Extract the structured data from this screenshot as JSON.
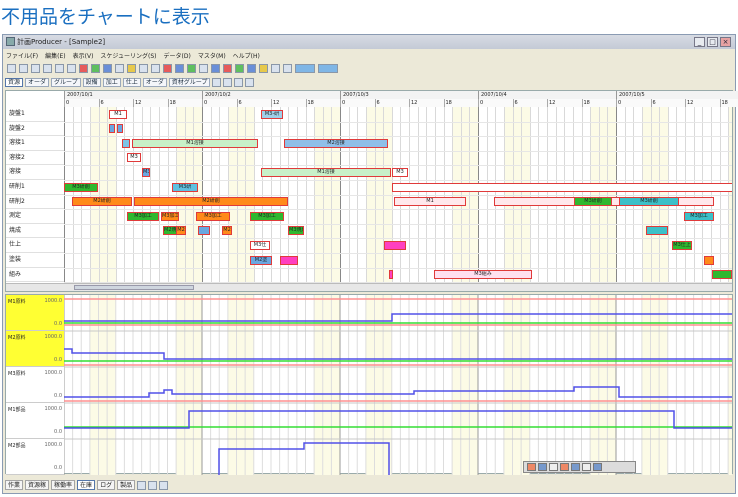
{
  "heading": "不用品をチャートに表示",
  "window": {
    "title": "計画Producer - [Sample2]",
    "min_label": "_",
    "max_label": "□",
    "close_label": "×"
  },
  "menu": [
    "ファイル(F)",
    "編集(E)",
    "表示(V)",
    "スケジューリング(S)",
    "データ(D)",
    "マスタ(M)",
    "ヘルプ(H)"
  ],
  "toolbar_icons": [
    "new-icon",
    "open-icon",
    "save-icon",
    "cut-icon",
    "copy-icon",
    "paste-icon",
    "undo-icon",
    "redo-icon",
    "find-icon",
    "replace-icon",
    "filter-icon",
    "zoom-in-icon",
    "zoom-out-icon",
    "chart-icon",
    "table-icon",
    "schedule-icon",
    "calendar-icon",
    "resource-icon",
    "order-icon",
    "item-icon",
    "process-icon",
    "link-icon",
    "arrow-left-icon",
    "arrow-right-icon",
    "bar-icon",
    "bar2-icon"
  ],
  "view_tabs": [
    "資源",
    "オーダ",
    "グループ",
    "設備",
    "加工",
    "仕上",
    "オーダ",
    "資材グループ"
  ],
  "dates": [
    "2007/10/1",
    "2007/10/2",
    "2007/10/3",
    "2007/10/4",
    "2007/10/5"
  ],
  "hours": [
    "0",
    "6",
    "12",
    "18"
  ],
  "resources": [
    "旋盤1",
    "旋盤2",
    "溶接1",
    "溶接2",
    "溶接",
    "研削1",
    "研削2",
    "測定",
    "焼成",
    "仕上",
    "塗装",
    "組み"
  ],
  "bars": [
    {
      "row": 0,
      "label": "M1",
      "color": "#ffffff"
    },
    {
      "row": 0,
      "label": "M3-研",
      "color": "#9ecfe8"
    },
    {
      "row": 1,
      "label": "",
      "color": "#6aa7e0"
    },
    {
      "row": 1,
      "label": "",
      "color": "#6aa7e0"
    },
    {
      "row": 2,
      "label": "",
      "color": "#7ec4e6"
    },
    {
      "row": 2,
      "label": "M1溶接",
      "color": "#c8f0c8"
    },
    {
      "row": 2,
      "label": "M2溶接",
      "color": "#8fbfe8"
    },
    {
      "row": 3,
      "label": "M3",
      "color": "#ffffff"
    },
    {
      "row": 4,
      "label": "M3",
      "color": "#6aa7e0"
    },
    {
      "row": 4,
      "label": "M1溶接",
      "color": "#c8f0c8"
    },
    {
      "row": 4,
      "label": "M3",
      "color": "#ffffff"
    },
    {
      "row": 5,
      "label": "M3研削",
      "color": "#2fb82f"
    },
    {
      "row": 5,
      "label": "M3研",
      "color": "#5fc0e0"
    },
    {
      "row": 5,
      "label": "",
      "color": "#ffffff"
    },
    {
      "row": 6,
      "label": "M2研削",
      "color": "#ff8a1a"
    },
    {
      "row": 6,
      "label": "M2研削",
      "color": "#ff8a1a"
    },
    {
      "row": 6,
      "label": "M1",
      "color": "#ffe8ec"
    },
    {
      "row": 6,
      "label": "M1",
      "color": "#ffe8ec"
    },
    {
      "row": 6,
      "label": "M3研削",
      "color": "#2fb82f"
    },
    {
      "row": 6,
      "label": "M3研削",
      "color": "#3cc0c8"
    },
    {
      "row": 7,
      "label": "M3加工",
      "color": "#2fb82f"
    },
    {
      "row": 7,
      "label": "M3加工",
      "color": "#ff8a1a"
    },
    {
      "row": 7,
      "label": "M3加工",
      "color": "#ff8a1a"
    },
    {
      "row": 7,
      "label": "M3加工",
      "color": "#2fb82f"
    },
    {
      "row": 7,
      "label": "M3加工",
      "color": "#3cc0c8"
    },
    {
      "row": 8,
      "label": "M2焼成",
      "color": "#2fb82f"
    },
    {
      "row": 8,
      "label": "M2",
      "color": "#ff8a1a"
    },
    {
      "row": 8,
      "label": "",
      "color": "#6aa7e0"
    },
    {
      "row": 8,
      "label": "M2",
      "color": "#ff8a1a"
    },
    {
      "row": 8,
      "label": "M3焼成",
      "color": "#2fb82f"
    },
    {
      "row": 8,
      "label": "",
      "color": "#3cc0c8"
    },
    {
      "row": 9,
      "label": "M3仕",
      "color": "#ffffff"
    },
    {
      "row": 9,
      "label": "",
      "color": "#ff3fc0"
    },
    {
      "row": 9,
      "label": "M3仕上",
      "color": "#2fb82f"
    },
    {
      "row": 10,
      "label": "M2塗",
      "color": "#6aa7e0"
    },
    {
      "row": 10,
      "label": "",
      "color": "#ff3fc0"
    },
    {
      "row": 10,
      "label": "",
      "color": "#ff8a1a"
    },
    {
      "row": 11,
      "label": "",
      "color": "#ff3fc0"
    },
    {
      "row": 11,
      "label": "M3組み",
      "color": "#ffe0f0"
    },
    {
      "row": 11,
      "label": "",
      "color": "#2fb82f"
    }
  ],
  "lower_charts": [
    {
      "name": "M1原料",
      "max": "1000.0",
      "min": "0.0",
      "highlight": true
    },
    {
      "name": "M2原料",
      "max": "1000.0",
      "min": "0.0",
      "highlight": true
    },
    {
      "name": "M3原料",
      "max": "1000.0",
      "min": "0.0",
      "highlight": false
    },
    {
      "name": "M1部品",
      "max": "1000.0",
      "min": "0.0",
      "highlight": false
    },
    {
      "name": "M2部品",
      "max": "1000.0",
      "min": "0.0",
      "highlight": false
    }
  ],
  "status_tabs": [
    "作業",
    "資源稼",
    "稼働率",
    "在庫",
    "ログ",
    "製品"
  ],
  "float_icons": [
    "save-icon",
    "undo-icon",
    "print-icon",
    "chart-icon",
    "zoom-icon",
    "settings-icon",
    "list-icon"
  ]
}
